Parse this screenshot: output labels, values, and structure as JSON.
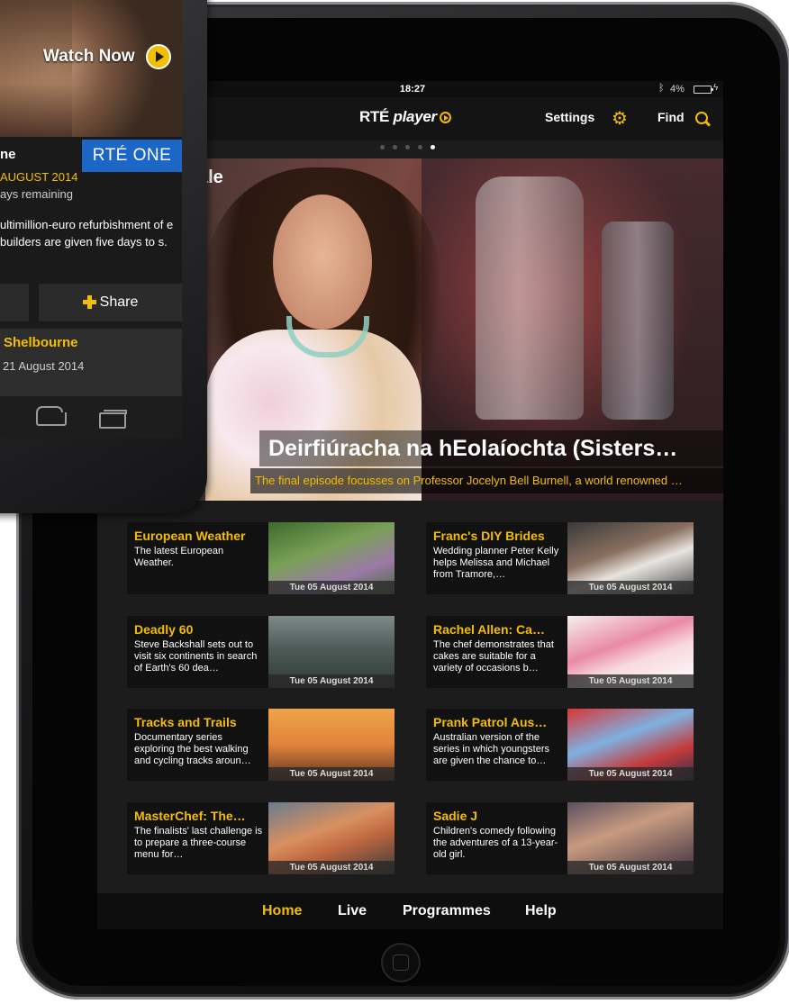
{
  "colors": {
    "accent": "#f4be00",
    "rte_one_blue": "#1c67c6",
    "screen_bg": "#1c1c1c"
  },
  "status_bar": {
    "time": "18:27",
    "battery": "4%",
    "bluetooth_icon": "bluetooth-icon",
    "battery_icon": "battery-icon"
  },
  "header": {
    "logo_prefix": "RTÉ",
    "logo_suffix": "player",
    "settings_label": "Settings",
    "find_label": "Find"
  },
  "carousel": {
    "page_count": 5,
    "active_index": 4
  },
  "hero": {
    "tag_text": "ale",
    "title": "Deirfiúracha na hEolaíochta (Sisters…",
    "subtitle": "The final episode focusses on Professor Jocelyn Bell Burnell, a world renowned …"
  },
  "cards": [
    {
      "title": "European Weather",
      "description": "The latest European Weather.",
      "date": "Tue 05 August 2014"
    },
    {
      "title": "Franc's DIY Brides",
      "description": "Wedding planner Peter Kelly helps Melissa and Michael from Tramore,…",
      "date": "Tue 05 August 2014"
    },
    {
      "title": "Deadly 60",
      "description": "Steve Backshall sets out to visit six continents in search of Earth's 60 dea…",
      "date": "Tue 05 August 2014"
    },
    {
      "title": "Rachel Allen: Ca…",
      "description": "The chef demonstrates that cakes are suitable for a variety of occasions b…",
      "date": "Tue 05 August 2014"
    },
    {
      "title": "Tracks and Trails",
      "description": "Documentary series exploring the best walking and cycling tracks aroun…",
      "date": "Tue 05 August 2014"
    },
    {
      "title": "Prank Patrol Aus…",
      "description": "Australian version of the series in which youngsters are given the chance to…",
      "date": "Tue 05 August 2014"
    },
    {
      "title": "MasterChef: The…",
      "description": "The finalists' last challenge is to prepare a three-course menu for…",
      "date": "Tue 05 August 2014"
    },
    {
      "title": "Sadie J",
      "description": "Children's comedy following the adventures of a 13-year-old girl.",
      "date": "Tue 05 August 2014"
    }
  ],
  "bottom_nav": {
    "home": "Home",
    "live": "Live",
    "programmes": "Programmes",
    "help": "Help",
    "active": "Home"
  },
  "phone": {
    "watch_now": "Watch Now",
    "title_fragment": "ne",
    "channel": "RTÉ ONE",
    "date_fragment": "AUGUST 2014",
    "remaining_fragment": "ays remaining",
    "description_fragment": "ultimillion-euro refurbishment of e builders are given five days to s.",
    "share_label": "Share",
    "related_title": "Shelbourne",
    "related_date": "21 August 2014"
  }
}
